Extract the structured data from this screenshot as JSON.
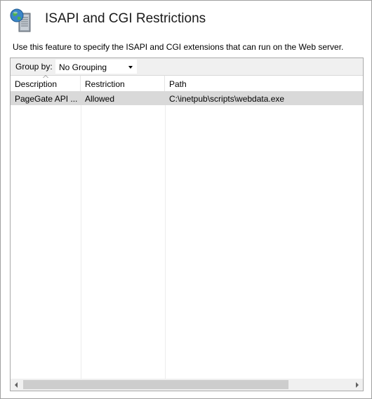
{
  "header": {
    "title": "ISAPI and CGI Restrictions",
    "icon": "server-globe-icon"
  },
  "description": "Use this feature to specify the ISAPI and CGI extensions that can run on the Web server.",
  "toolbar": {
    "group_by_label": "Group by:",
    "group_by_value": "No Grouping"
  },
  "table": {
    "columns": [
      "Description",
      "Restriction",
      "Path"
    ],
    "rows": [
      {
        "description": "PageGate API ...",
        "restriction": "Allowed",
        "path": "C:\\inetpub\\scripts\\webdata.exe"
      }
    ]
  },
  "colors": {
    "selected_row": "#d9d9d9",
    "toolbar_bg": "#f0f0f0",
    "scroll_thumb": "#cdcdcd"
  }
}
